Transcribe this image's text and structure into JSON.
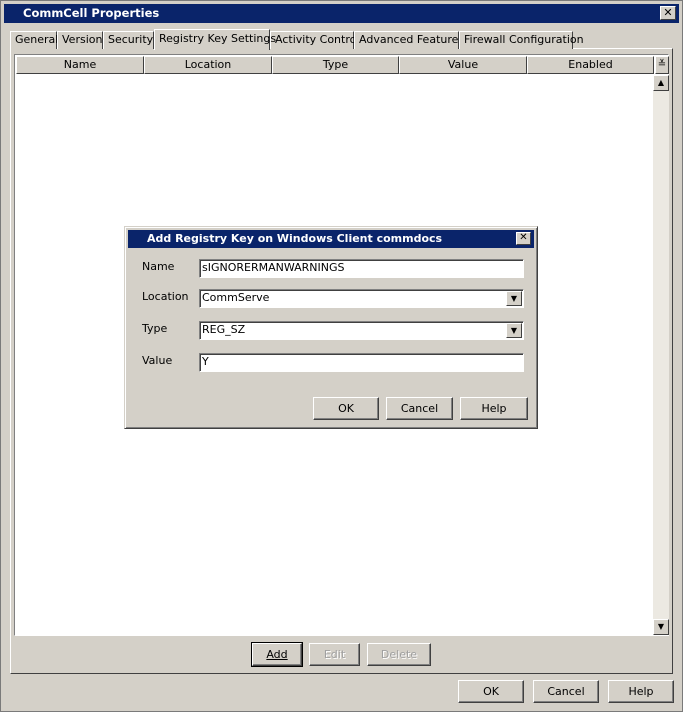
{
  "window": {
    "title": "CommCell Properties"
  },
  "tabs": [
    {
      "label": "General"
    },
    {
      "label": "Version"
    },
    {
      "label": "Security"
    },
    {
      "label": "Registry Key Settings"
    },
    {
      "label": "Activity Control"
    },
    {
      "label": "Advanced Features"
    },
    {
      "label": "Firewall Configuration"
    }
  ],
  "active_tab": "Registry Key Settings",
  "table": {
    "columns": [
      "Name",
      "Location",
      "Type",
      "Value",
      "Enabled"
    ]
  },
  "panel_buttons": {
    "add": "Add",
    "edit": "Edit",
    "delete": "Delete"
  },
  "dialog": {
    "title": "Add Registry Key on Windows Client  commdocs",
    "name_label": "Name",
    "name_value": "sIGNORERMANWARNINGS",
    "location_label": "Location",
    "location_value": "CommServe",
    "type_label": "Type",
    "type_value": "REG_SZ",
    "value_label": "Value",
    "value_value": "Y",
    "ok": "OK",
    "cancel": "Cancel",
    "help": "Help"
  },
  "footer": {
    "ok": "OK",
    "cancel": "Cancel",
    "help": "Help"
  },
  "icons": {
    "close": "close-icon",
    "dropdown": "chevron-down-icon",
    "column_chooser": "double-chevron-down-icon"
  }
}
